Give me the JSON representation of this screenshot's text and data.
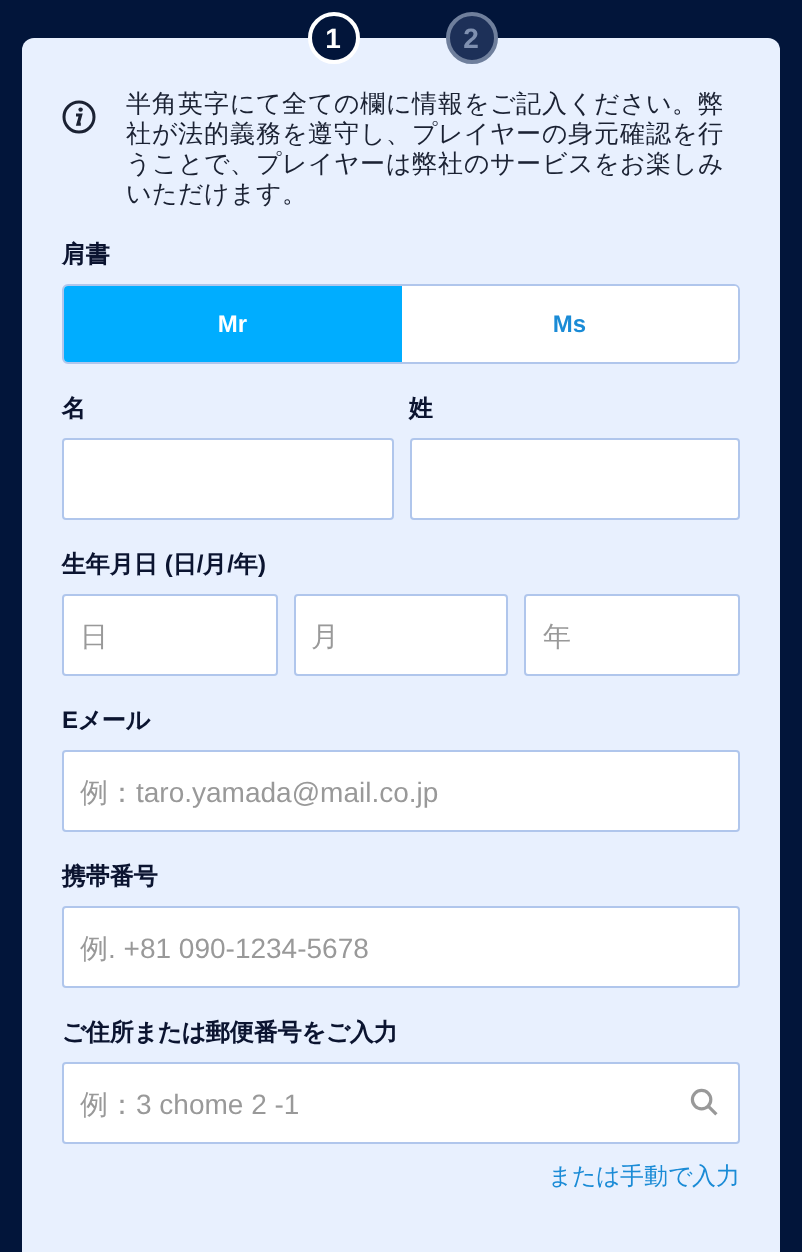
{
  "steps": [
    {
      "label": "1",
      "selected": true
    },
    {
      "label": "2",
      "selected": false
    }
  ],
  "notice": "半角英字にて全ての欄に情報をご記入ください。弊社が法的義務を遵守し、プレイヤーの身元確認を行うことで、プレイヤーは弊社のサービスをお楽しみいただけます。",
  "title_field": {
    "label": "肩書",
    "options": [
      {
        "label": "Mr",
        "selected": true
      },
      {
        "label": "Ms",
        "selected": false
      }
    ]
  },
  "sections": [
    {
      "kind": "pair",
      "fields": [
        {
          "label": "名"
        },
        {
          "label": "姓"
        }
      ]
    },
    {
      "kind": "group",
      "label": "生年月日 (日/月/年)",
      "fields": [
        {
          "placeholder": "日"
        },
        {
          "placeholder": "月"
        },
        {
          "placeholder": "年"
        }
      ]
    },
    {
      "kind": "group",
      "label": "Eメール",
      "fields": [
        {
          "placeholder": "例：taro.yamada@mail.co.jp"
        }
      ]
    },
    {
      "kind": "group",
      "label": "携帯番号",
      "fields": [
        {
          "placeholder": "例. +81 090-1234-5678"
        }
      ]
    },
    {
      "kind": "group",
      "label": "ご住所または郵便番号をご入力",
      "fields": [
        {
          "placeholder": "例：3 chome 2 -1",
          "kind": "search"
        }
      ]
    }
  ],
  "manual_link": "または手動で入力"
}
